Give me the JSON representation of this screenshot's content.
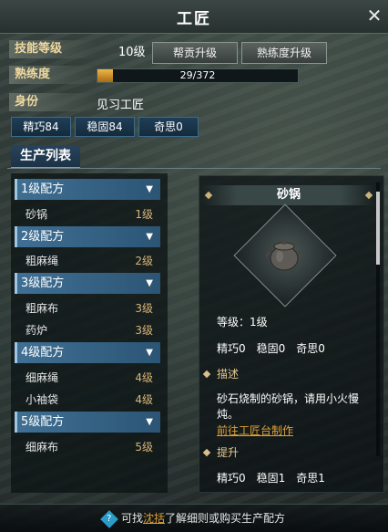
{
  "window": {
    "title": "工匠",
    "close_label": "✕"
  },
  "skill": {
    "level_label": "技能等级",
    "level_value": "10级",
    "btn_help": "帮贡升级",
    "btn_prof": "熟练度升级",
    "prof_label": "熟练度",
    "prof_text": "29/372",
    "prof_fraction": 0.078,
    "identity_label": "身份",
    "identity_value": "见习工匠",
    "attrs": [
      "精巧84",
      "稳固84",
      "奇思0"
    ]
  },
  "tab": {
    "label": "生产列表"
  },
  "list": {
    "categories": [
      {
        "label": "1级配方",
        "items": [
          {
            "name": "砂锅",
            "level": "1级"
          }
        ]
      },
      {
        "label": "2级配方",
        "items": [
          {
            "name": "粗麻绳",
            "level": "2级"
          }
        ]
      },
      {
        "label": "3级配方",
        "items": [
          {
            "name": "粗麻布",
            "level": "3级"
          },
          {
            "name": "药炉",
            "level": "3级"
          }
        ]
      },
      {
        "label": "4级配方",
        "items": [
          {
            "name": "细麻绳",
            "level": "4级"
          },
          {
            "name": "小袖袋",
            "level": "4级"
          }
        ]
      },
      {
        "label": "5级配方",
        "items": [
          {
            "name": "细麻布",
            "level": "5级"
          }
        ]
      }
    ]
  },
  "detail": {
    "name": "砂锅",
    "level_line": "等级：1级",
    "stats_line": "精巧0　稳固0　奇思0",
    "desc_title": "描述",
    "desc_text": "砂石烧制的砂锅，请用小火慢炖。",
    "link_text": "前往工匠台制作",
    "upgrade_title": "提升",
    "upgrade_line": "精巧0　稳固1　奇思1"
  },
  "footer": {
    "icon": "?",
    "prefix": "可找",
    "link": "沈括",
    "suffix": "了解细则或购买生产配方"
  }
}
